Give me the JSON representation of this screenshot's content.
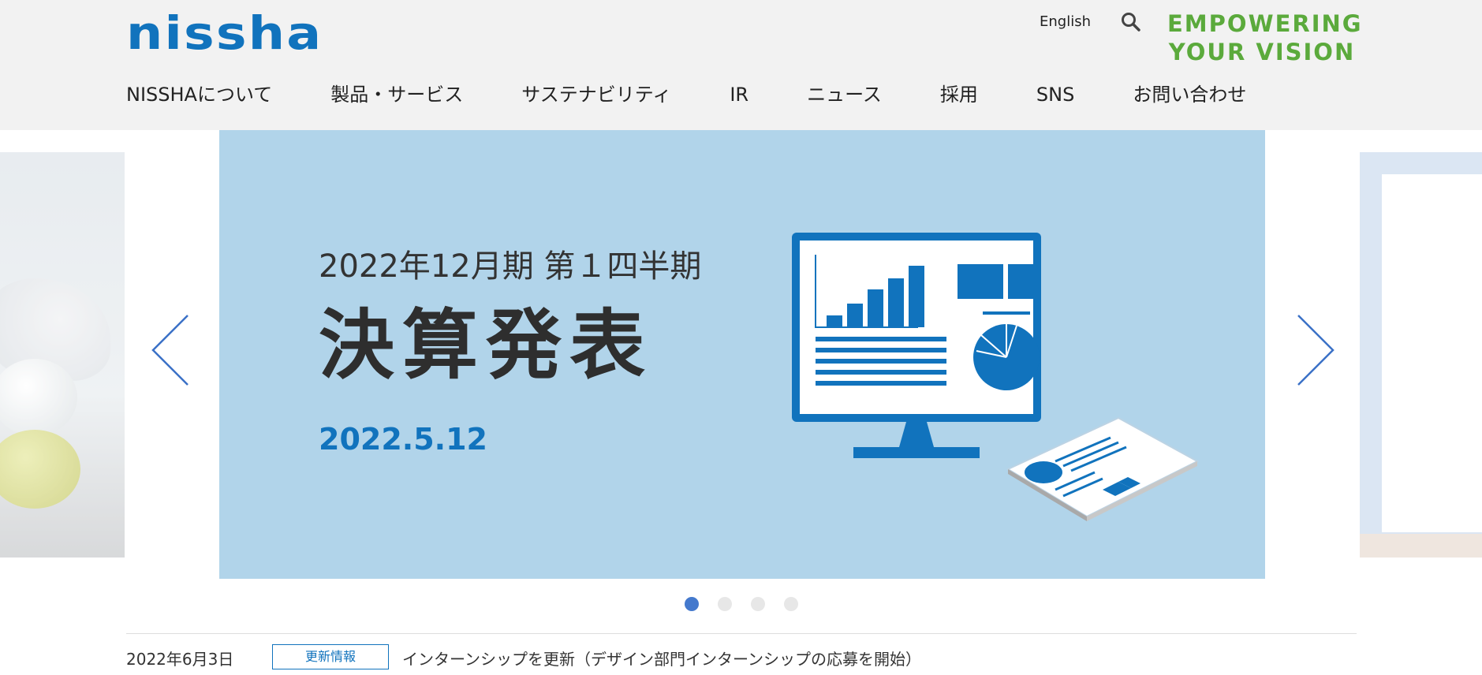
{
  "header": {
    "logo_text": "NISSHA",
    "language_link": "English",
    "tagline_line1": "EMPOWERING",
    "tagline_line2": "YOUR VISION"
  },
  "nav": {
    "items": [
      {
        "label": "NISSHAについて"
      },
      {
        "label": "製品・サービス"
      },
      {
        "label": "サステナビリティ"
      },
      {
        "label": "IR"
      },
      {
        "label": "ニュース"
      },
      {
        "label": "採用"
      },
      {
        "label": "SNS"
      },
      {
        "label": "お問い合わせ"
      }
    ]
  },
  "carousel": {
    "active_slide": {
      "subtitle": "2022年12月期 第１四半期",
      "title": "決算発表",
      "date": "2022.5.12"
    },
    "dot_count": 4,
    "active_index": 1
  },
  "news": [
    {
      "date": "2022年6月3日",
      "category": "更新情報",
      "text": "インターンシップを更新（デザイン部門インターンシップの応募を開始）"
    }
  ],
  "icons": {
    "search": "search-icon",
    "prev": "chevron-left-icon",
    "next": "chevron-right-icon"
  },
  "colors": {
    "brand_blue": "#1173BD",
    "tagline_green": "#5BAA3C",
    "header_bg": "#F2F2F2",
    "slide_bg": "#B1D4EA",
    "dot_active": "#4479CD",
    "dot_inactive": "#E7E7E7"
  }
}
